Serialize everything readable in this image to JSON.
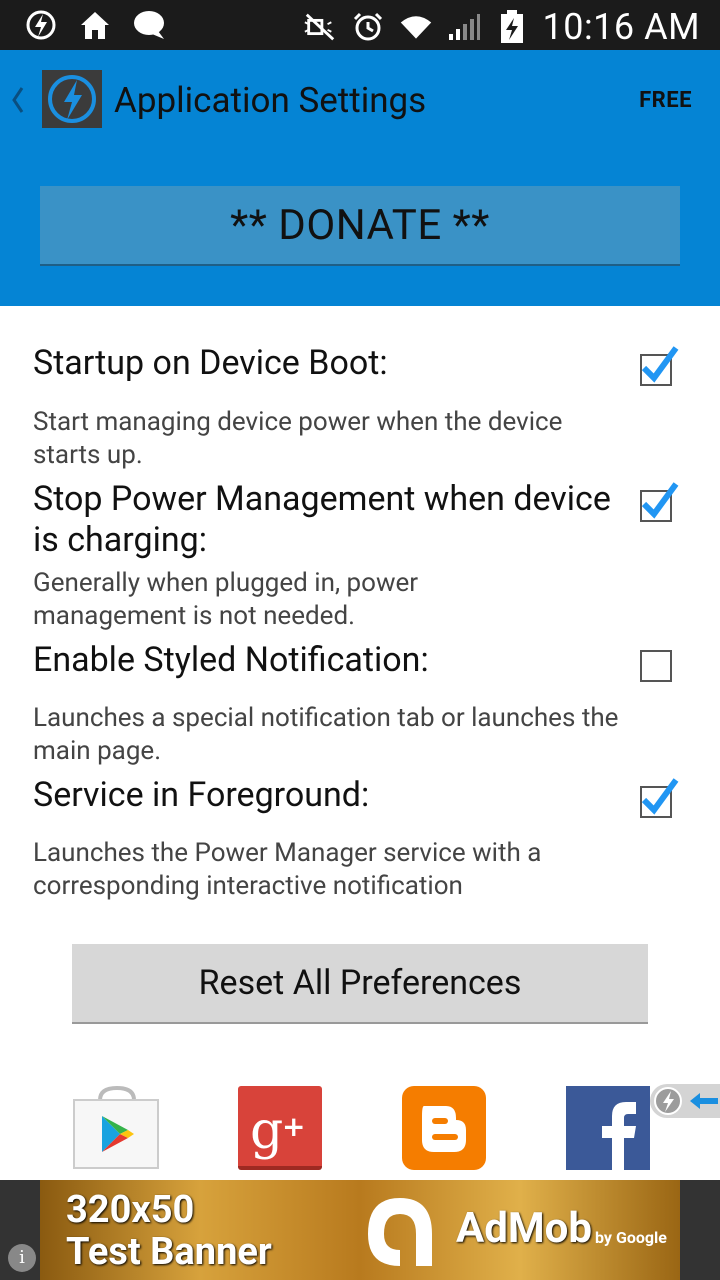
{
  "status_bar": {
    "time": "10:16 AM",
    "left_icons": [
      "flash-icon",
      "home-icon",
      "chat-bubble-icon"
    ],
    "right_icons": [
      "mute-icon",
      "alarm-icon",
      "wifi-icon",
      "signal-icon",
      "battery-icon"
    ]
  },
  "action_bar": {
    "title": "Application Settings",
    "badge": "FREE",
    "donate_label": "** DONATE **",
    "background": "#0584d4"
  },
  "preferences": [
    {
      "title": "Startup on Device Boot:",
      "description": "Start managing device power when the device starts up.",
      "checked": true
    },
    {
      "title": "Stop Power Management when device is charging:",
      "description": "Generally when plugged in, power management is not needed.",
      "checked": true
    },
    {
      "title": "Enable Styled Notification:",
      "description": "Launches a special notification tab or launches the main page.",
      "checked": false
    },
    {
      "title": "Service in Foreground:",
      "description": "Launches the Power Manager service with a corresponding interactive notification",
      "checked": true
    }
  ],
  "reset_label": "Reset All Preferences",
  "social": [
    "play-store-icon",
    "google-plus-icon",
    "blogger-icon",
    "facebook-icon"
  ],
  "ad": {
    "line1": "320x50",
    "line2": "Test Banner",
    "brand": "AdMob",
    "by": "by Google",
    "info": "i"
  }
}
